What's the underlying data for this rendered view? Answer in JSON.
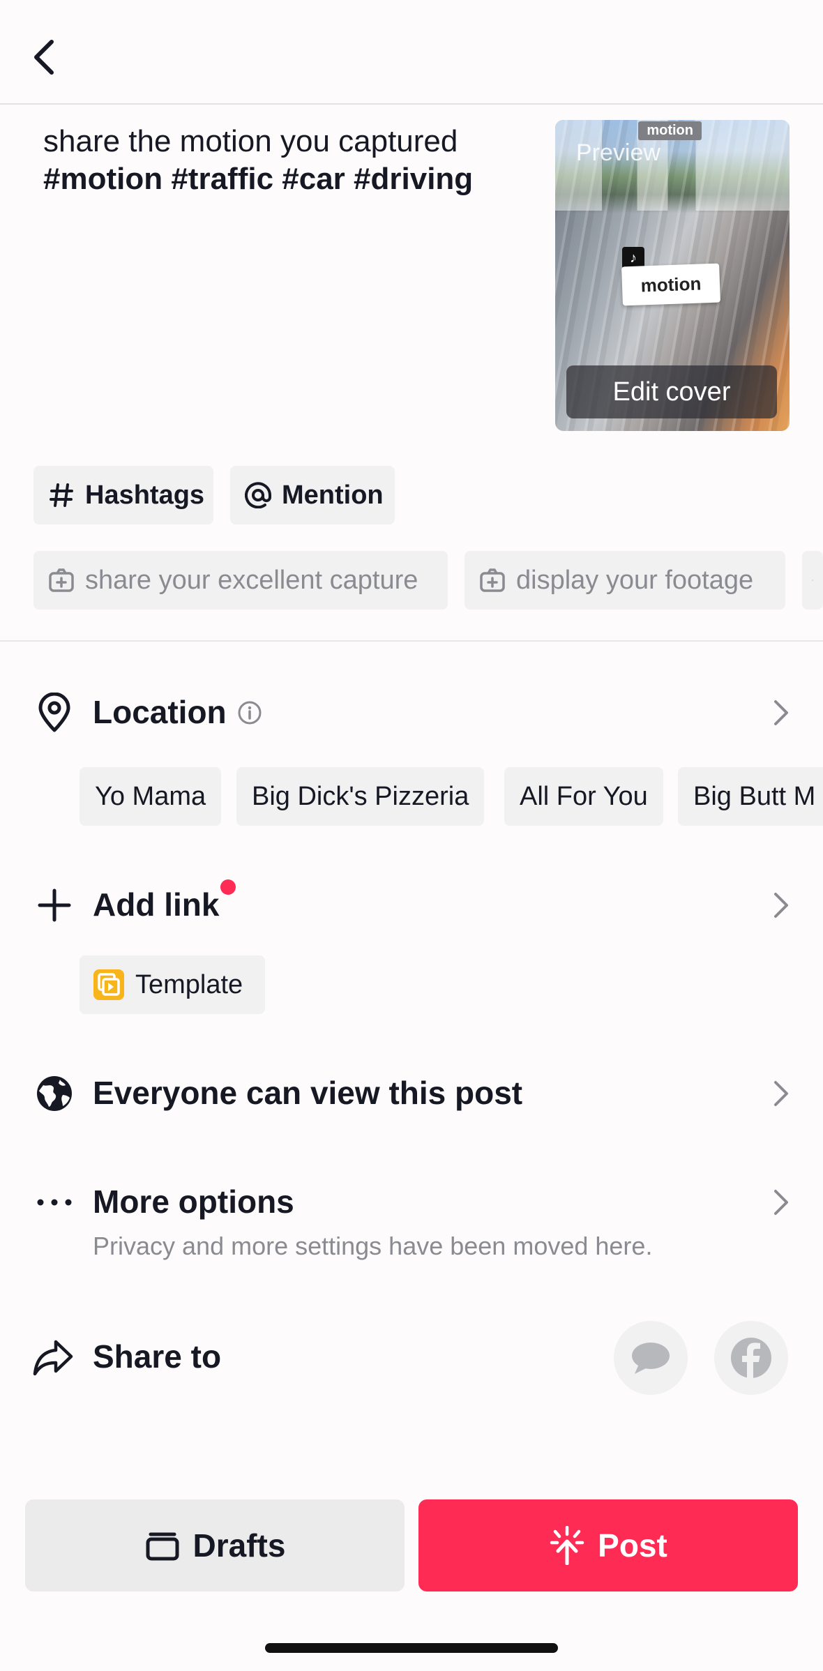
{
  "header": {
    "back_icon": "chevron-left-icon"
  },
  "caption": {
    "text": "share the motion you captured",
    "hashtags": "#motion #traffic #car #driving"
  },
  "cover": {
    "tag": "motion",
    "preview_label": "Preview",
    "sticker_text": "motion",
    "edit_label": "Edit cover"
  },
  "chips": {
    "hashtags_label": "Hashtags",
    "mention_label": "Mention",
    "suggestions": [
      "share your excellent capture",
      "display your footage"
    ]
  },
  "location": {
    "title": "Location",
    "places": [
      "Yo Mama",
      "Big Dick's Pizzeria",
      "All For You",
      "Big Butt M"
    ]
  },
  "add_link": {
    "title": "Add link",
    "template_label": "Template"
  },
  "visibility": {
    "title": "Everyone can view this post"
  },
  "more_options": {
    "title": "More options",
    "subtitle": "Privacy and more settings have been moved here."
  },
  "share": {
    "title": "Share to",
    "targets": [
      "message-icon",
      "facebook-icon"
    ]
  },
  "actions": {
    "drafts_label": "Drafts",
    "post_label": "Post"
  },
  "colors": {
    "accent": "#fe2c55",
    "chip_bg": "#f1f1f2",
    "muted_text": "#8a8b91"
  }
}
